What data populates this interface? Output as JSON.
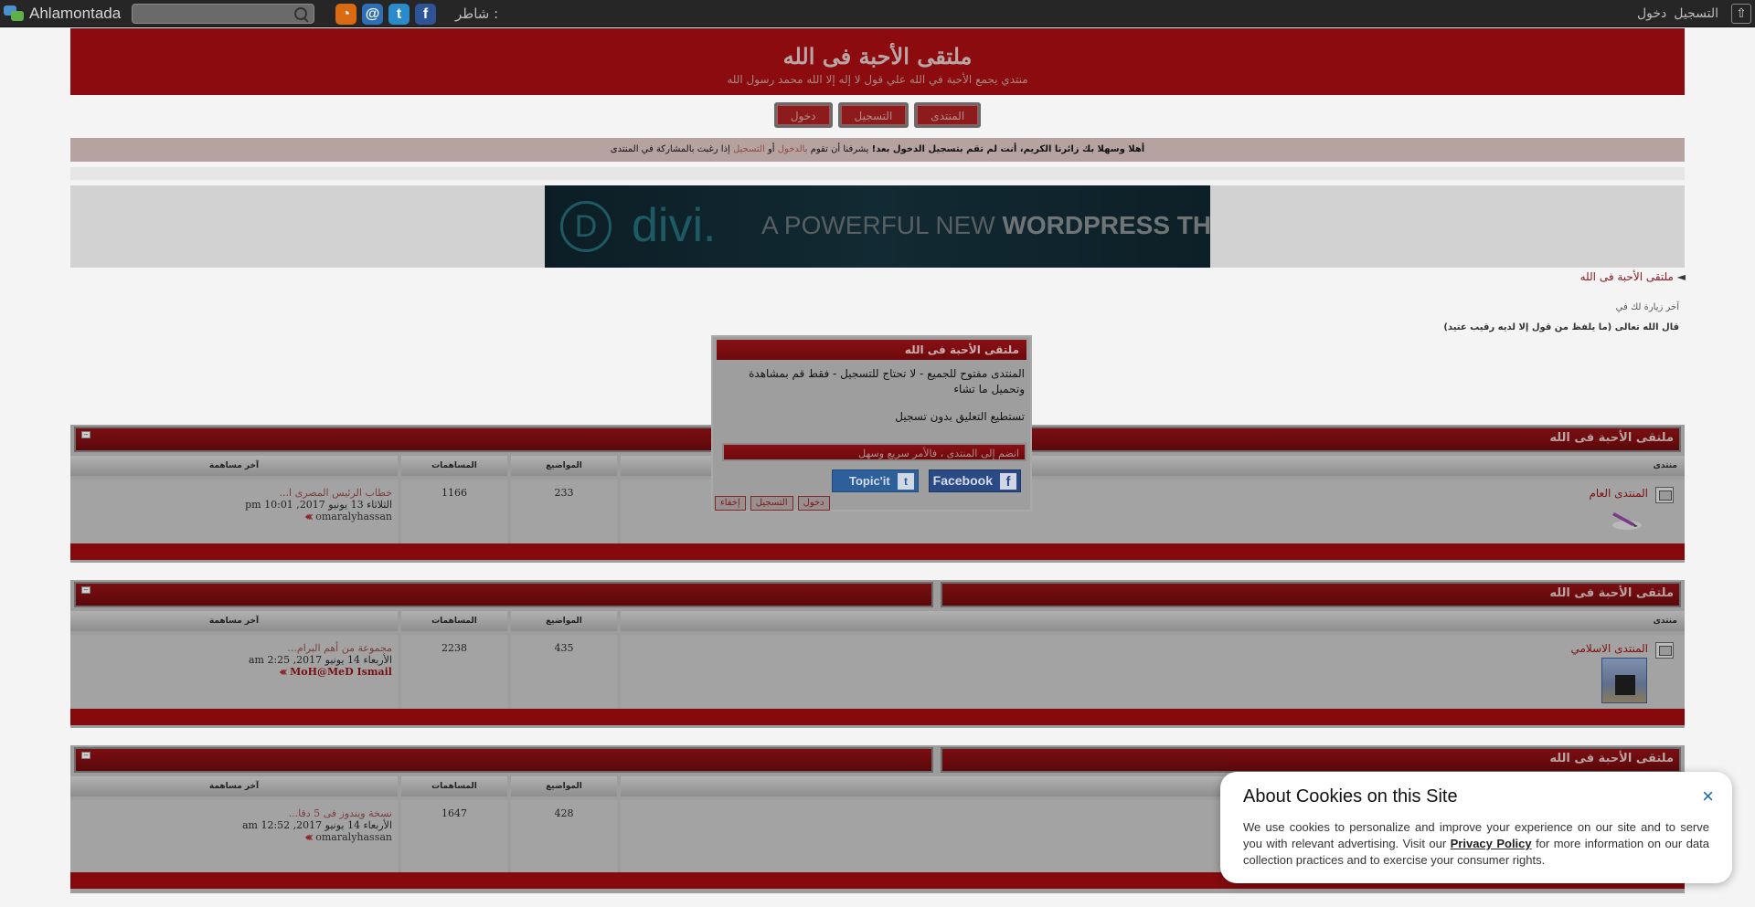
{
  "topbar": {
    "brand": "Ahlamontada",
    "search_placeholder": "",
    "share_label": "شاطر :",
    "register": "التسجيل",
    "login": "دخول"
  },
  "header": {
    "title": "ملتقى الأحبة فى الله",
    "subtitle": "منتدي يجمع الأحبة في الله علي قول لا إله إلا الله محمد رسول الله"
  },
  "nav": {
    "forum": "المنتدى",
    "register": "التسجيل",
    "login": "دخول"
  },
  "welcome": {
    "part1": "أهلا وسهلا بك زائرنا الكريم، أنت لم تقم بتسجيل الدخول بعد!",
    "part2": "يشرفنا أن تقوم",
    "login_link": "بالدخول",
    "part3": "أو",
    "register_link": "التسجيل",
    "part4": "إذا رغبت بالمشاركة في المنتدى"
  },
  "banner": {
    "logo_letter": "D",
    "brand": "divi.",
    "tagline_a": "A POWERFUL NEW",
    "tagline_b": "WORDPRESS THEME"
  },
  "breadcrumb": "ملتقى الأحبة فى الله",
  "last_visit": "آخر زيارة لك في",
  "verse": "قال الله تعالى (ما يلفظ من قول إلا لديه رقيب عتيد)",
  "columns": {
    "forum": "منتدى",
    "topics": "المواضيع",
    "posts": "المساهمات",
    "last_post": "آخر مساهمة"
  },
  "sections": [
    {
      "category": "ملتقى الأحبة فى الله",
      "forum_name": "المنتدى العام",
      "topics": "233",
      "posts": "1166",
      "last_title": "خطاب الرئيس المصرى ا...",
      "last_date": "الثلاثاء 13 يونيو 2017, 10:01 pm",
      "last_author": "omaralyhassan"
    },
    {
      "category": "ملتقى الأحبة فى الله",
      "forum_name": "المنتدى الاسلامي",
      "topics": "435",
      "posts": "2238",
      "last_title": "مجموعة من أهم البرام...",
      "last_date": "الأربعاء 14 يونيو 2017, 2:25 am",
      "last_author": "MoH@MeD Ismail"
    },
    {
      "category": "ملتقى الأحبة فى الله",
      "forum_name": "",
      "topics": "428",
      "posts": "1647",
      "last_title": "نسخة ويندوز فى 5 دقا...",
      "last_date": "الأربعاء 14 يونيو 2017, 12:52 am",
      "last_author": "omaralyhassan"
    }
  ],
  "modal": {
    "title": "ملتقى الأحبة فى الله",
    "line1": "المنتدى مفتوح للجميع - لا تحتاج للتسجيل - فقط قم بمشاهدة وتحميل ما تشاء",
    "line2": "تستطيع التعليق بدون تسجيل",
    "join": "انضم إلى المنتدى ، فالأمر سريع وسهل",
    "facebook": "Facebook",
    "topicit": "Topic'it",
    "login": "دخول",
    "register": "التسجيل",
    "hide": "إخفاء"
  },
  "cookie": {
    "title": "About Cookies on this Site",
    "text_a": "We use cookies to personalize and improve your experience on our site and to serve you with relevant advertising. Visit our ",
    "link": "Privacy Policy",
    "text_b": " for more information on our data collection practices and to exercise your consumer rights.",
    "close": "×"
  }
}
